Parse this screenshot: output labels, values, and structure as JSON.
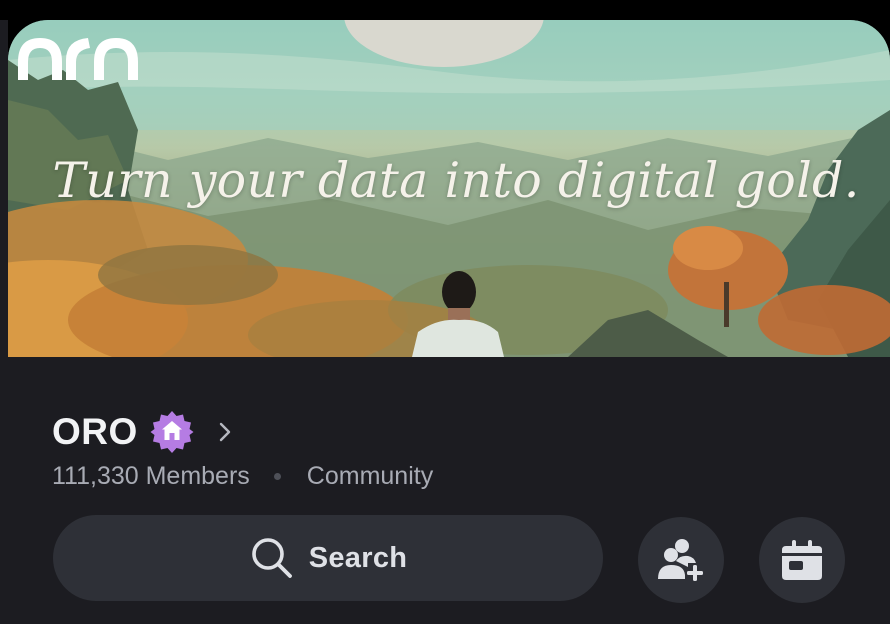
{
  "banner": {
    "tagline": "Turn your data into digital gold."
  },
  "server": {
    "name": "ORO",
    "badge_icon": "home-icon",
    "badge_color": "#b57ce3",
    "members_text": "111,330 Members",
    "category": "Community"
  },
  "actions": {
    "search_label": "Search",
    "search_icon": "search-icon",
    "invite_icon": "add-user-icon",
    "events_icon": "calendar-icon"
  },
  "colors": {
    "background": "#1c1c21",
    "button_bg": "#2e3037",
    "text_primary": "#f2f3f5",
    "text_secondary": "#a8abb4"
  }
}
